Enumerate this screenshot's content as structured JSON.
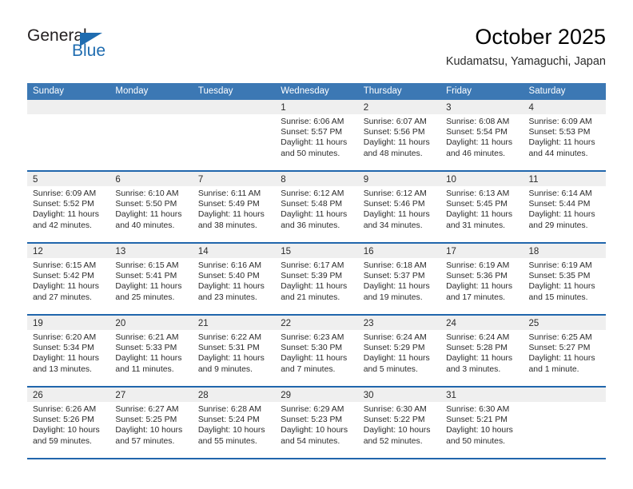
{
  "brand": {
    "name_top": "General",
    "name_bottom": "Blue",
    "color_dark": "#231f20",
    "color_blue": "#1f6cb0"
  },
  "header": {
    "title": "October 2025",
    "subtitle": "Kudamatsu, Yamaguchi, Japan"
  },
  "theme": {
    "header_blue": "#3c78b4",
    "separator_blue": "#2166ac",
    "day_band_gray": "#efefef"
  },
  "weekdays": [
    "Sunday",
    "Monday",
    "Tuesday",
    "Wednesday",
    "Thursday",
    "Friday",
    "Saturday"
  ],
  "weeks": [
    [
      {
        "day": "",
        "empty": true,
        "sunrise": "",
        "sunset": "",
        "daylight_line1": "",
        "daylight_line2": ""
      },
      {
        "day": "",
        "empty": true,
        "sunrise": "",
        "sunset": "",
        "daylight_line1": "",
        "daylight_line2": ""
      },
      {
        "day": "",
        "empty": true,
        "sunrise": "",
        "sunset": "",
        "daylight_line1": "",
        "daylight_line2": ""
      },
      {
        "day": "1",
        "empty": false,
        "sunrise": "Sunrise: 6:06 AM",
        "sunset": "Sunset: 5:57 PM",
        "daylight_line1": "Daylight: 11 hours",
        "daylight_line2": "and 50 minutes."
      },
      {
        "day": "2",
        "empty": false,
        "sunrise": "Sunrise: 6:07 AM",
        "sunset": "Sunset: 5:56 PM",
        "daylight_line1": "Daylight: 11 hours",
        "daylight_line2": "and 48 minutes."
      },
      {
        "day": "3",
        "empty": false,
        "sunrise": "Sunrise: 6:08 AM",
        "sunset": "Sunset: 5:54 PM",
        "daylight_line1": "Daylight: 11 hours",
        "daylight_line2": "and 46 minutes."
      },
      {
        "day": "4",
        "empty": false,
        "sunrise": "Sunrise: 6:09 AM",
        "sunset": "Sunset: 5:53 PM",
        "daylight_line1": "Daylight: 11 hours",
        "daylight_line2": "and 44 minutes."
      }
    ],
    [
      {
        "day": "5",
        "empty": false,
        "sunrise": "Sunrise: 6:09 AM",
        "sunset": "Sunset: 5:52 PM",
        "daylight_line1": "Daylight: 11 hours",
        "daylight_line2": "and 42 minutes."
      },
      {
        "day": "6",
        "empty": false,
        "sunrise": "Sunrise: 6:10 AM",
        "sunset": "Sunset: 5:50 PM",
        "daylight_line1": "Daylight: 11 hours",
        "daylight_line2": "and 40 minutes."
      },
      {
        "day": "7",
        "empty": false,
        "sunrise": "Sunrise: 6:11 AM",
        "sunset": "Sunset: 5:49 PM",
        "daylight_line1": "Daylight: 11 hours",
        "daylight_line2": "and 38 minutes."
      },
      {
        "day": "8",
        "empty": false,
        "sunrise": "Sunrise: 6:12 AM",
        "sunset": "Sunset: 5:48 PM",
        "daylight_line1": "Daylight: 11 hours",
        "daylight_line2": "and 36 minutes."
      },
      {
        "day": "9",
        "empty": false,
        "sunrise": "Sunrise: 6:12 AM",
        "sunset": "Sunset: 5:46 PM",
        "daylight_line1": "Daylight: 11 hours",
        "daylight_line2": "and 34 minutes."
      },
      {
        "day": "10",
        "empty": false,
        "sunrise": "Sunrise: 6:13 AM",
        "sunset": "Sunset: 5:45 PM",
        "daylight_line1": "Daylight: 11 hours",
        "daylight_line2": "and 31 minutes."
      },
      {
        "day": "11",
        "empty": false,
        "sunrise": "Sunrise: 6:14 AM",
        "sunset": "Sunset: 5:44 PM",
        "daylight_line1": "Daylight: 11 hours",
        "daylight_line2": "and 29 minutes."
      }
    ],
    [
      {
        "day": "12",
        "empty": false,
        "sunrise": "Sunrise: 6:15 AM",
        "sunset": "Sunset: 5:42 PM",
        "daylight_line1": "Daylight: 11 hours",
        "daylight_line2": "and 27 minutes."
      },
      {
        "day": "13",
        "empty": false,
        "sunrise": "Sunrise: 6:15 AM",
        "sunset": "Sunset: 5:41 PM",
        "daylight_line1": "Daylight: 11 hours",
        "daylight_line2": "and 25 minutes."
      },
      {
        "day": "14",
        "empty": false,
        "sunrise": "Sunrise: 6:16 AM",
        "sunset": "Sunset: 5:40 PM",
        "daylight_line1": "Daylight: 11 hours",
        "daylight_line2": "and 23 minutes."
      },
      {
        "day": "15",
        "empty": false,
        "sunrise": "Sunrise: 6:17 AM",
        "sunset": "Sunset: 5:39 PM",
        "daylight_line1": "Daylight: 11 hours",
        "daylight_line2": "and 21 minutes."
      },
      {
        "day": "16",
        "empty": false,
        "sunrise": "Sunrise: 6:18 AM",
        "sunset": "Sunset: 5:37 PM",
        "daylight_line1": "Daylight: 11 hours",
        "daylight_line2": "and 19 minutes."
      },
      {
        "day": "17",
        "empty": false,
        "sunrise": "Sunrise: 6:19 AM",
        "sunset": "Sunset: 5:36 PM",
        "daylight_line1": "Daylight: 11 hours",
        "daylight_line2": "and 17 minutes."
      },
      {
        "day": "18",
        "empty": false,
        "sunrise": "Sunrise: 6:19 AM",
        "sunset": "Sunset: 5:35 PM",
        "daylight_line1": "Daylight: 11 hours",
        "daylight_line2": "and 15 minutes."
      }
    ],
    [
      {
        "day": "19",
        "empty": false,
        "sunrise": "Sunrise: 6:20 AM",
        "sunset": "Sunset: 5:34 PM",
        "daylight_line1": "Daylight: 11 hours",
        "daylight_line2": "and 13 minutes."
      },
      {
        "day": "20",
        "empty": false,
        "sunrise": "Sunrise: 6:21 AM",
        "sunset": "Sunset: 5:33 PM",
        "daylight_line1": "Daylight: 11 hours",
        "daylight_line2": "and 11 minutes."
      },
      {
        "day": "21",
        "empty": false,
        "sunrise": "Sunrise: 6:22 AM",
        "sunset": "Sunset: 5:31 PM",
        "daylight_line1": "Daylight: 11 hours",
        "daylight_line2": "and 9 minutes."
      },
      {
        "day": "22",
        "empty": false,
        "sunrise": "Sunrise: 6:23 AM",
        "sunset": "Sunset: 5:30 PM",
        "daylight_line1": "Daylight: 11 hours",
        "daylight_line2": "and 7 minutes."
      },
      {
        "day": "23",
        "empty": false,
        "sunrise": "Sunrise: 6:24 AM",
        "sunset": "Sunset: 5:29 PM",
        "daylight_line1": "Daylight: 11 hours",
        "daylight_line2": "and 5 minutes."
      },
      {
        "day": "24",
        "empty": false,
        "sunrise": "Sunrise: 6:24 AM",
        "sunset": "Sunset: 5:28 PM",
        "daylight_line1": "Daylight: 11 hours",
        "daylight_line2": "and 3 minutes."
      },
      {
        "day": "25",
        "empty": false,
        "sunrise": "Sunrise: 6:25 AM",
        "sunset": "Sunset: 5:27 PM",
        "daylight_line1": "Daylight: 11 hours",
        "daylight_line2": "and 1 minute."
      }
    ],
    [
      {
        "day": "26",
        "empty": false,
        "sunrise": "Sunrise: 6:26 AM",
        "sunset": "Sunset: 5:26 PM",
        "daylight_line1": "Daylight: 10 hours",
        "daylight_line2": "and 59 minutes."
      },
      {
        "day": "27",
        "empty": false,
        "sunrise": "Sunrise: 6:27 AM",
        "sunset": "Sunset: 5:25 PM",
        "daylight_line1": "Daylight: 10 hours",
        "daylight_line2": "and 57 minutes."
      },
      {
        "day": "28",
        "empty": false,
        "sunrise": "Sunrise: 6:28 AM",
        "sunset": "Sunset: 5:24 PM",
        "daylight_line1": "Daylight: 10 hours",
        "daylight_line2": "and 55 minutes."
      },
      {
        "day": "29",
        "empty": false,
        "sunrise": "Sunrise: 6:29 AM",
        "sunset": "Sunset: 5:23 PM",
        "daylight_line1": "Daylight: 10 hours",
        "daylight_line2": "and 54 minutes."
      },
      {
        "day": "30",
        "empty": false,
        "sunrise": "Sunrise: 6:30 AM",
        "sunset": "Sunset: 5:22 PM",
        "daylight_line1": "Daylight: 10 hours",
        "daylight_line2": "and 52 minutes."
      },
      {
        "day": "31",
        "empty": false,
        "sunrise": "Sunrise: 6:30 AM",
        "sunset": "Sunset: 5:21 PM",
        "daylight_line1": "Daylight: 10 hours",
        "daylight_line2": "and 50 minutes."
      },
      {
        "day": "",
        "empty": true,
        "sunrise": "",
        "sunset": "",
        "daylight_line1": "",
        "daylight_line2": ""
      }
    ]
  ]
}
